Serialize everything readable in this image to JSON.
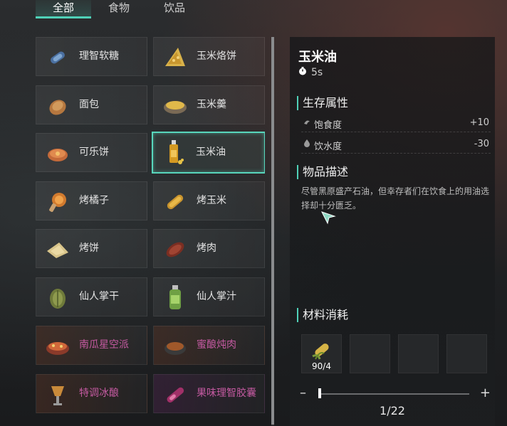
{
  "tabs": [
    {
      "label": "全部",
      "active": true
    },
    {
      "label": "食物",
      "active": false
    },
    {
      "label": "饮品",
      "active": false
    }
  ],
  "items": [
    {
      "label": "理智软糖",
      "icon": "candy-icon"
    },
    {
      "label": "玉米烙饼",
      "icon": "corn-pancake-icon"
    },
    {
      "label": "面包",
      "icon": "bread-icon"
    },
    {
      "label": "玉米羹",
      "icon": "corn-soup-icon"
    },
    {
      "label": "可乐饼",
      "icon": "croquette-icon"
    },
    {
      "label": "玉米油",
      "icon": "corn-oil-icon"
    },
    {
      "label": "烤橘子",
      "icon": "roasted-orange-icon"
    },
    {
      "label": "烤玉米",
      "icon": "roasted-corn-icon"
    },
    {
      "label": "烤饼",
      "icon": "flatbread-icon"
    },
    {
      "label": "烤肉",
      "icon": "roasted-meat-icon"
    },
    {
      "label": "仙人掌干",
      "icon": "dried-cactus-icon"
    },
    {
      "label": "仙人掌汁",
      "icon": "cactus-juice-icon"
    },
    {
      "label": "南瓜星空派",
      "icon": "pumpkin-pie-icon"
    },
    {
      "label": "蜜酿炖肉",
      "icon": "honey-stew-icon"
    },
    {
      "label": "特调冰酿",
      "icon": "iced-brew-icon"
    },
    {
      "label": "果味理智胶囊",
      "icon": "fruit-capsule-icon"
    }
  ],
  "detail": {
    "name": "玉米油",
    "time": "5s",
    "survival_title": "生存属性",
    "stats": [
      {
        "label": "饱食度",
        "value": "+10",
        "icon": "hunger-icon"
      },
      {
        "label": "饮水度",
        "value": "-30",
        "icon": "water-drop-icon"
      }
    ],
    "description_title": "物品描述",
    "description": "尽管黑原盛产石油，但幸存者们在饮食上的用油选择却十分匮乏。",
    "materials_title": "材料消耗",
    "materials": [
      {
        "count": "90/4",
        "icon": "corn-icon"
      }
    ],
    "craft_count": 1,
    "craft_max": 22,
    "page_count": "1/22"
  },
  "colors": {
    "accent": "#4fd1b8",
    "epic_text": "#c45aa1"
  }
}
